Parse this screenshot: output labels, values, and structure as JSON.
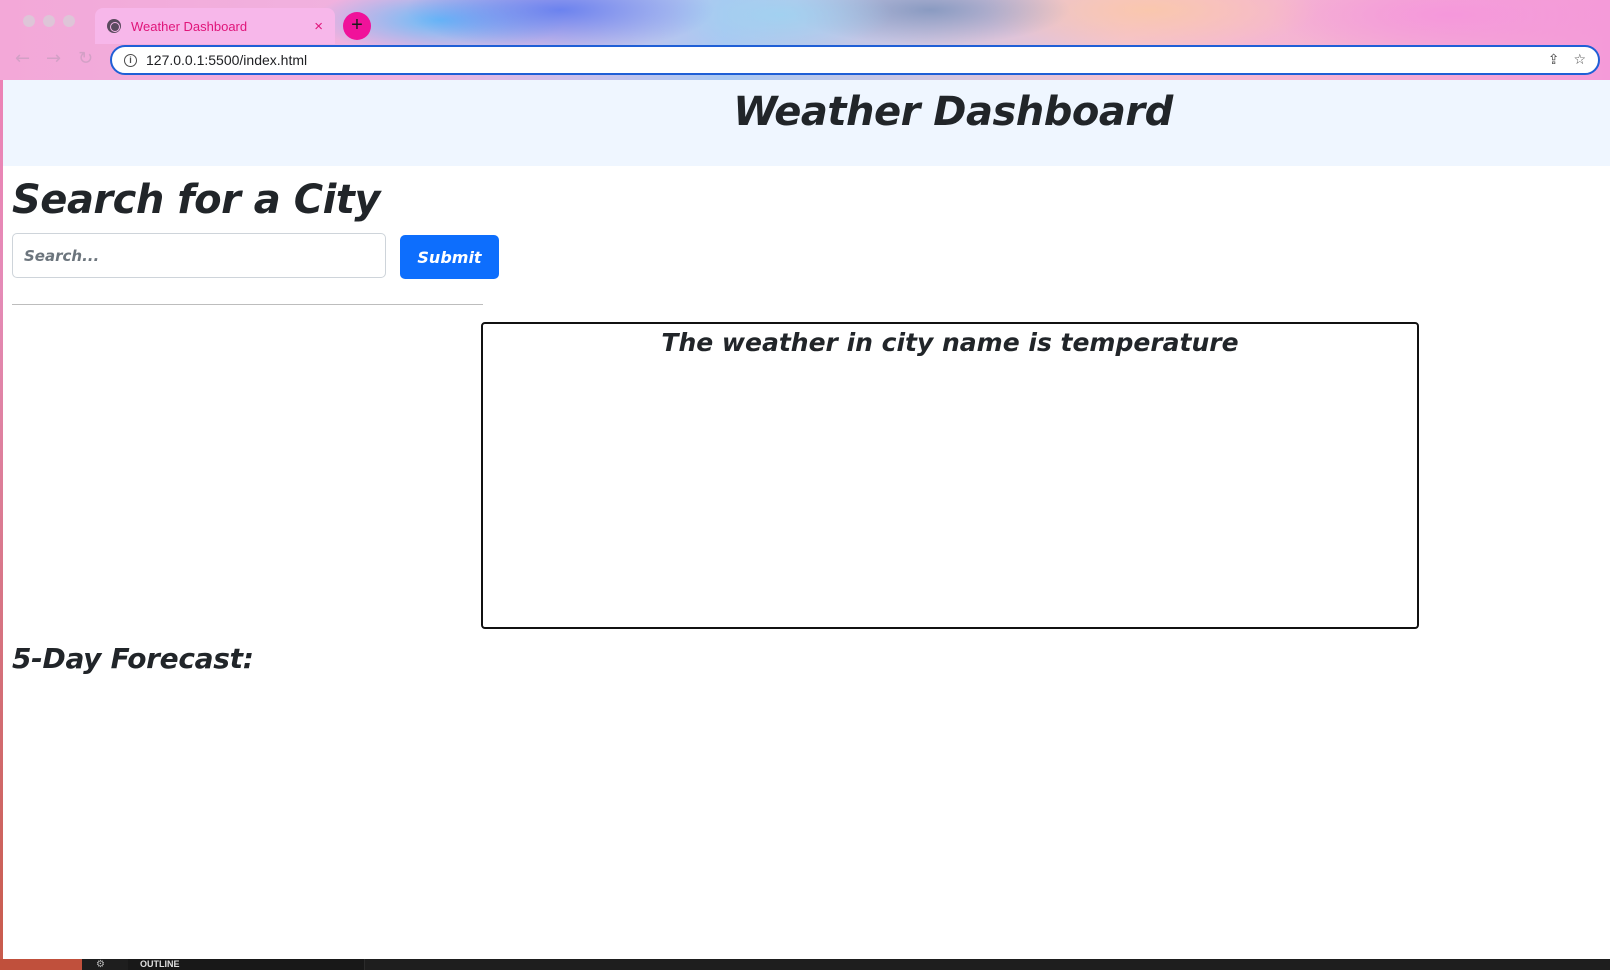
{
  "browser": {
    "tab_title": "Weather Dashboard",
    "tab_close": "×",
    "new_tab": "+",
    "url": "127.0.0.1:5500/index.html",
    "nav": {
      "back": "←",
      "forward": "→",
      "reload": "↻"
    },
    "icons": {
      "info": "i",
      "share": "⇪",
      "bookmark": "☆"
    }
  },
  "page": {
    "title": "Weather Dashboard",
    "search_heading": "Search for a City",
    "search_placeholder": "Search...",
    "submit_label": "Submit",
    "current_weather_text": "The weather in city name is temperature",
    "forecast_heading": "5-Day Forecast:"
  },
  "editor": {
    "outline_label": "OUTLINE",
    "gear": "⚙"
  },
  "colors": {
    "accent": "#0d6efd",
    "header_band": "#eff6ff",
    "text": "#212529"
  }
}
